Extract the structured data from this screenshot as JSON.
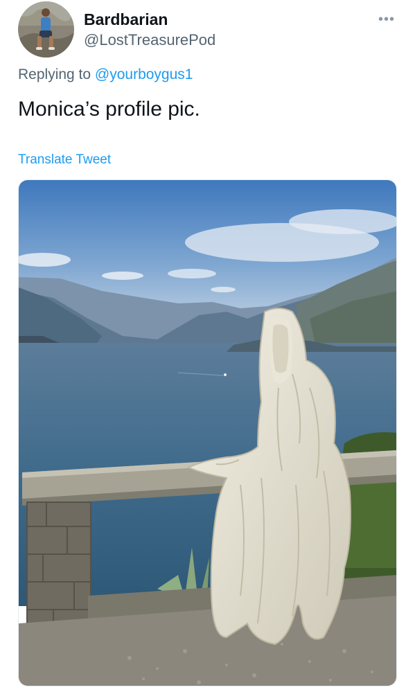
{
  "tweet": {
    "display_name": "Bardbarian",
    "handle": "@LostTreasurePod",
    "more_icon": "more-horizontal-icon",
    "reply_prefix": "Replying to",
    "reply_mention": "@yourboygus1",
    "text": "Monica’s profile pic.",
    "translate_label": "Translate Tweet"
  },
  "colors": {
    "text_primary": "#0f1419",
    "text_secondary": "#536471",
    "link": "#1d9bf0"
  }
}
